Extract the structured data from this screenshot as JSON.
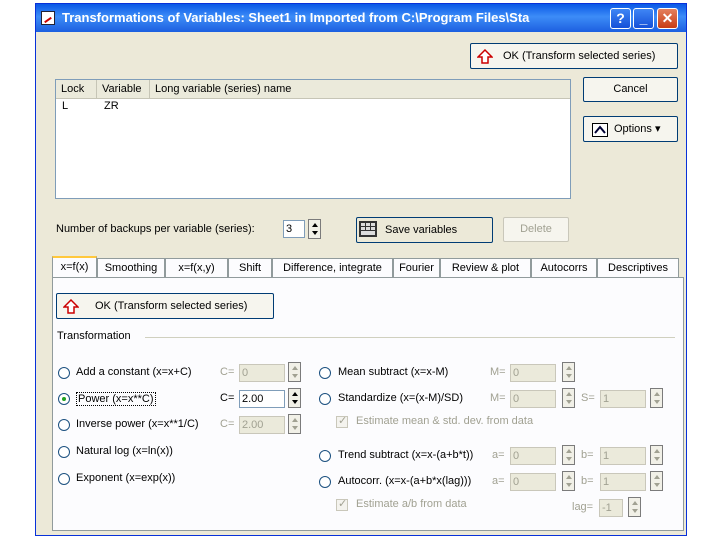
{
  "window": {
    "title": "Transformations of Variables: Sheet1 in Imported from C:\\Program Files\\Sta",
    "help_btn": "?",
    "min_btn": "_",
    "close_btn": "✕"
  },
  "top_buttons": {
    "ok": "OK (Transform selected series)",
    "cancel": "Cancel",
    "options": "Options ▾"
  },
  "variables_list": {
    "columns": [
      "Lock",
      "Variable",
      "Long variable (series) name"
    ],
    "rows": [
      {
        "lock": "L",
        "variable": "ZR",
        "long_name": ""
      }
    ]
  },
  "backups": {
    "label": "Number of backups per variable (series):",
    "value": "3",
    "save_label": "Save variables",
    "delete_label": "Delete"
  },
  "tabs": [
    "x=f(x)",
    "Smoothing",
    "x=f(x,y)",
    "Shift",
    "Difference, integrate",
    "Fourier",
    "Review & plot",
    "Autocorrs",
    "Descriptives"
  ],
  "panel": {
    "ok_label": "OK (Transform selected series)",
    "group_label": "Transformation",
    "left_options": [
      {
        "label": "Add a constant (x=x+C)",
        "param": "C=",
        "value": "0",
        "selected": false,
        "enabled": false
      },
      {
        "label": "Power (x=x**C)",
        "param": "C=",
        "value": "2.00",
        "selected": true,
        "enabled": true
      },
      {
        "label": "Inverse power (x=x**1/C)",
        "param": "C=",
        "value": "2.00",
        "selected": false,
        "enabled": false
      },
      {
        "label": "Natural log (x=ln(x))",
        "selected": false
      },
      {
        "label": "Exponent (x=exp(x))",
        "selected": false
      }
    ],
    "right_options": {
      "mean_subtract": {
        "label": "Mean subtract (x=x-M)",
        "param": "M=",
        "value": "0"
      },
      "standardize": {
        "label": "Standardize (x=(x-M)/SD)",
        "param_m": "M=",
        "value_m": "0",
        "param_s": "S=",
        "value_s": "1"
      },
      "estimate_mean": "Estimate mean & std. dev. from data",
      "trend_subtract": {
        "label": "Trend subtract (x=x-(a+b*t))",
        "param_a": "a=",
        "value_a": "0",
        "param_b": "b=",
        "value_b": "1"
      },
      "autocorr": {
        "label": "Autocorr. (x=x-(a+b*x(lag)))",
        "param_a": "a=",
        "value_a": "0",
        "param_b": "b=",
        "value_b": "1"
      },
      "estimate_ab": "Estimate a/b from data",
      "lag_label": "lag=",
      "lag_value": "-1"
    }
  }
}
